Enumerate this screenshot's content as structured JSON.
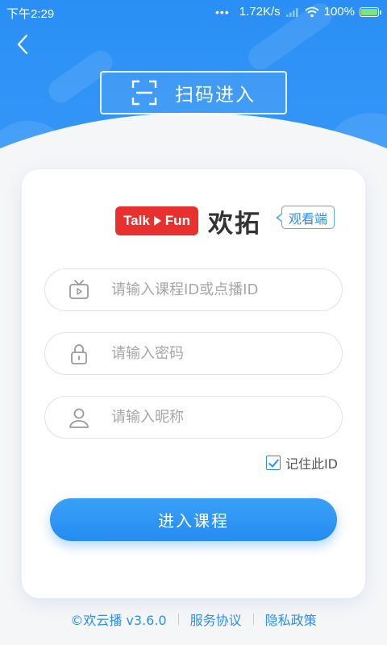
{
  "status_bar": {
    "time": "下午2:29",
    "dots": "•••",
    "network_speed": "1.72K/s",
    "battery_percent": "100%",
    "battery_level": 1.0
  },
  "header": {
    "back_icon": "chevron-left-icon",
    "scan_label": "扫码进入",
    "scan_icon": "scan-frame-icon",
    "accent_color": "#2a8ff5"
  },
  "brand": {
    "logo_text_left": "Talk",
    "logo_text_right": "Fun",
    "logo_color": "#e8302f",
    "name": "欢拓",
    "tag": "观看端"
  },
  "form": {
    "course_id": {
      "placeholder": "请输入课程ID或点播ID",
      "value": "",
      "icon": "tv-icon"
    },
    "password": {
      "placeholder": "请输入密码",
      "value": "",
      "icon": "lock-icon"
    },
    "nickname": {
      "placeholder": "请输入昵称",
      "value": "",
      "icon": "user-icon"
    },
    "remember_id": {
      "label": "记住此ID",
      "checked": true
    },
    "submit_label": "进入课程"
  },
  "footer": {
    "copyright": "©欢云播 v3.6.0",
    "terms": "服务协议",
    "privacy": "隐私政策"
  }
}
